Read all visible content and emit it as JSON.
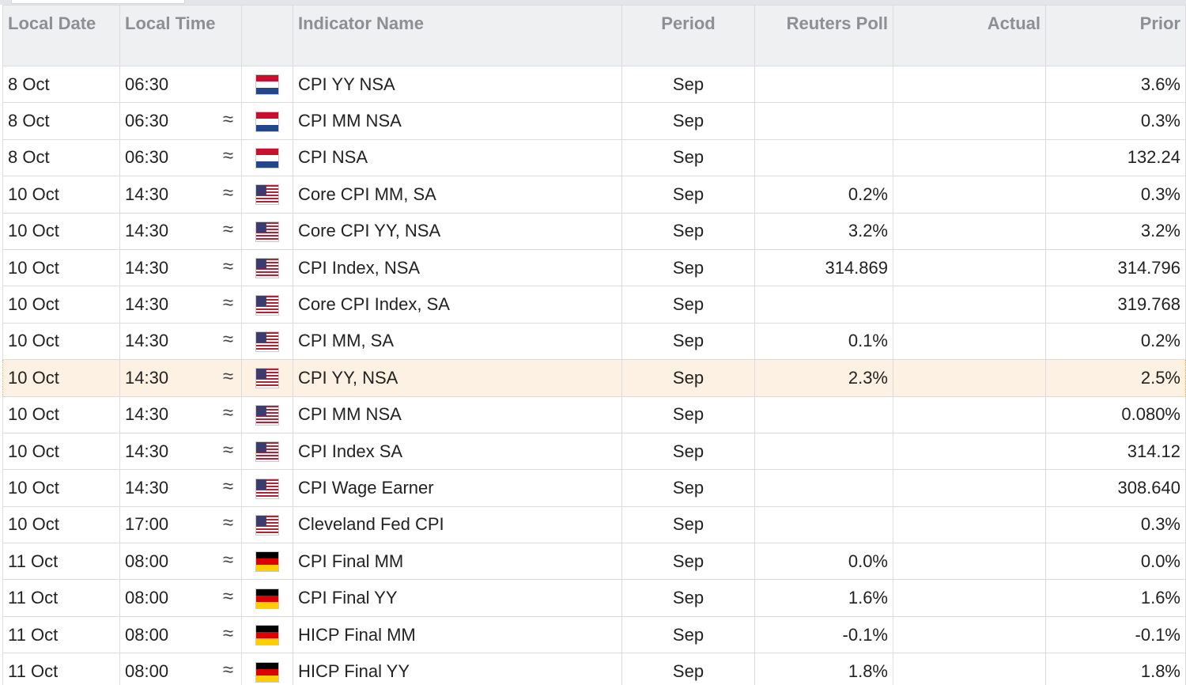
{
  "columns": {
    "local_date": "Local Date",
    "local_time": "Local Time",
    "flag": "",
    "indicator_name": "Indicator Name",
    "period": "Period",
    "reuters_poll": "Reuters Poll",
    "actual": "Actual",
    "prior": "Prior"
  },
  "colors": {
    "poll_text": "#1a82d6",
    "header_bg": "#eff0f2",
    "highlight_bg": "#fcf1e2",
    "highlight_border": "#e6a24a"
  },
  "rows": [
    {
      "date": "8 Oct",
      "time": "06:30",
      "approx": "",
      "flag": "netherlands-flag-icon",
      "name": "CPI YY NSA",
      "period": "Sep",
      "poll": "",
      "actual": "",
      "prior": "3.6%",
      "highlighted": false
    },
    {
      "date": "8 Oct",
      "time": "06:30",
      "approx": "≈",
      "flag": "netherlands-flag-icon",
      "name": "CPI MM NSA",
      "period": "Sep",
      "poll": "",
      "actual": "",
      "prior": "0.3%",
      "highlighted": false
    },
    {
      "date": "8 Oct",
      "time": "06:30",
      "approx": "≈",
      "flag": "netherlands-flag-icon",
      "name": "CPI NSA",
      "period": "Sep",
      "poll": "",
      "actual": "",
      "prior": "132.24",
      "highlighted": false
    },
    {
      "date": "10 Oct",
      "time": "14:30",
      "approx": "≈",
      "flag": "us-flag-icon",
      "name": "Core CPI MM, SA",
      "period": "Sep",
      "poll": "0.2%",
      "actual": "",
      "prior": "0.3%",
      "highlighted": false
    },
    {
      "date": "10 Oct",
      "time": "14:30",
      "approx": "≈",
      "flag": "us-flag-icon",
      "name": "Core CPI YY, NSA",
      "period": "Sep",
      "poll": "3.2%",
      "actual": "",
      "prior": "3.2%",
      "highlighted": false
    },
    {
      "date": "10 Oct",
      "time": "14:30",
      "approx": "≈",
      "flag": "us-flag-icon",
      "name": "CPI Index, NSA",
      "period": "Sep",
      "poll": "314.869",
      "actual": "",
      "prior": "314.796",
      "highlighted": false
    },
    {
      "date": "10 Oct",
      "time": "14:30",
      "approx": "≈",
      "flag": "us-flag-icon",
      "name": "Core CPI Index, SA",
      "period": "Sep",
      "poll": "",
      "actual": "",
      "prior": "319.768",
      "highlighted": false
    },
    {
      "date": "10 Oct",
      "time": "14:30",
      "approx": "≈",
      "flag": "us-flag-icon",
      "name": "CPI MM, SA",
      "period": "Sep",
      "poll": "0.1%",
      "actual": "",
      "prior": "0.2%",
      "highlighted": false
    },
    {
      "date": "10 Oct",
      "time": "14:30",
      "approx": "≈",
      "flag": "us-flag-icon",
      "name": "CPI YY, NSA",
      "period": "Sep",
      "poll": "2.3%",
      "actual": "",
      "prior": "2.5%",
      "highlighted": true
    },
    {
      "date": "10 Oct",
      "time": "14:30",
      "approx": "≈",
      "flag": "us-flag-icon",
      "name": "CPI MM NSA",
      "period": "Sep",
      "poll": "",
      "actual": "",
      "prior": "0.080%",
      "highlighted": false
    },
    {
      "date": "10 Oct",
      "time": "14:30",
      "approx": "≈",
      "flag": "us-flag-icon",
      "name": "CPI Index SA",
      "period": "Sep",
      "poll": "",
      "actual": "",
      "prior": "314.12",
      "highlighted": false
    },
    {
      "date": "10 Oct",
      "time": "14:30",
      "approx": "≈",
      "flag": "us-flag-icon",
      "name": "CPI Wage Earner",
      "period": "Sep",
      "poll": "",
      "actual": "",
      "prior": "308.640",
      "highlighted": false
    },
    {
      "date": "10 Oct",
      "time": "17:00",
      "approx": "≈",
      "flag": "us-flag-icon",
      "name": "Cleveland Fed CPI",
      "period": "Sep",
      "poll": "",
      "actual": "",
      "prior": "0.3%",
      "highlighted": false
    },
    {
      "date": "11 Oct",
      "time": "08:00",
      "approx": "≈",
      "flag": "germany-flag-icon",
      "name": "CPI Final MM",
      "period": "Sep",
      "poll": "0.0%",
      "actual": "",
      "prior": "0.0%",
      "highlighted": false
    },
    {
      "date": "11 Oct",
      "time": "08:00",
      "approx": "≈",
      "flag": "germany-flag-icon",
      "name": "CPI Final YY",
      "period": "Sep",
      "poll": "1.6%",
      "actual": "",
      "prior": "1.6%",
      "highlighted": false
    },
    {
      "date": "11 Oct",
      "time": "08:00",
      "approx": "≈",
      "flag": "germany-flag-icon",
      "name": "HICP Final MM",
      "period": "Sep",
      "poll": "-0.1%",
      "actual": "",
      "prior": "-0.1%",
      "highlighted": false
    },
    {
      "date": "11 Oct",
      "time": "08:00",
      "approx": "≈",
      "flag": "germany-flag-icon",
      "name": "HICP Final YY",
      "period": "Sep",
      "poll": "1.8%",
      "actual": "",
      "prior": "1.8%",
      "highlighted": false
    }
  ]
}
